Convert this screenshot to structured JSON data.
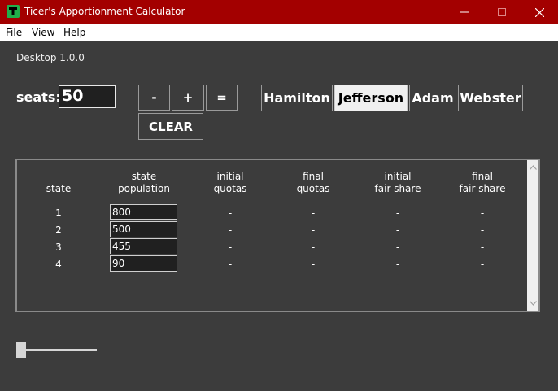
{
  "window": {
    "title": "Ticer's Apportionment Calculator",
    "icon": "app-t-icon",
    "controls": [
      "minimize-icon",
      "maximize-icon",
      "close-icon"
    ]
  },
  "menu": [
    "File",
    "View",
    "Help"
  ],
  "version": "Desktop 1.0.0",
  "seats": {
    "label": "seats:",
    "value": "50"
  },
  "controls": {
    "minus": "-",
    "plus": "+",
    "equals": "=",
    "clear": "CLEAR"
  },
  "methods": {
    "items": [
      "Hamilton",
      "Jefferson",
      "Adam",
      "Webster"
    ],
    "selected": "Jefferson"
  },
  "table": {
    "headers": {
      "state": "state",
      "pop_line1": "state",
      "pop_line2": "population",
      "iq_line1": "initial",
      "iq_line2": "quotas",
      "fq_line1": "final",
      "fq_line2": "quotas",
      "ifs_line1": "initial",
      "ifs_line2": "fair share",
      "ffs_line1": "final",
      "ffs_line2": "fair share"
    },
    "rows": [
      {
        "state": "1",
        "population": "800",
        "initial_quota": "-",
        "final_quota": "-",
        "initial_fair_share": "-",
        "final_fair_share": "-"
      },
      {
        "state": "2",
        "population": "500",
        "initial_quota": "-",
        "final_quota": "-",
        "initial_fair_share": "-",
        "final_fair_share": "-"
      },
      {
        "state": "3",
        "population": "455",
        "initial_quota": "-",
        "final_quota": "-",
        "initial_fair_share": "-",
        "final_fair_share": "-"
      },
      {
        "state": "4",
        "population": "90",
        "initial_quota": "-",
        "final_quota": "-",
        "initial_fair_share": "-",
        "final_fair_share": "-"
      }
    ]
  },
  "slider": {
    "value": 0
  },
  "colors": {
    "titlebar": "#a30000",
    "background": "#3c3c3c",
    "selected_method": "#f0f0f0",
    "app_icon": "#20b04a"
  }
}
